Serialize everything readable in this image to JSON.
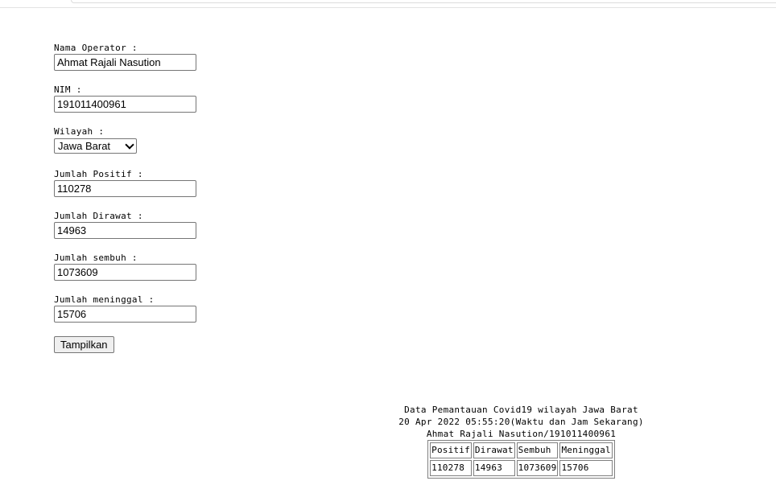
{
  "form": {
    "operator_label": "Nama Operator :",
    "operator_value": "Ahmat Rajali Nasution",
    "nim_label": "NIM :",
    "nim_value": "191011400961",
    "wilayah_label": "Wilayah :",
    "wilayah_value": "Jawa Barat",
    "positif_label": "Jumlah Positif :",
    "positif_value": "110278",
    "dirawat_label": "Jumlah Dirawat :",
    "dirawat_value": "14963",
    "sembuh_label": "Jumlah sembuh :",
    "sembuh_value": "1073609",
    "meninggal_label": "Jumlah meninggal :",
    "meninggal_value": "15706",
    "submit_label": "Tampilkan"
  },
  "report": {
    "title": "Data Pemantauan Covid19 wilayah Jawa Barat",
    "datetime": "20 Apr 2022 05:55:20(Waktu dan Jam Sekarang)",
    "operator": "Ahmat Rajali Nasution/191011400961",
    "table": {
      "headers": [
        "Positif",
        "Dirawat",
        "Sembuh",
        "Meninggal"
      ],
      "row": [
        "110278",
        "14963",
        "1073609",
        "15706"
      ]
    }
  }
}
